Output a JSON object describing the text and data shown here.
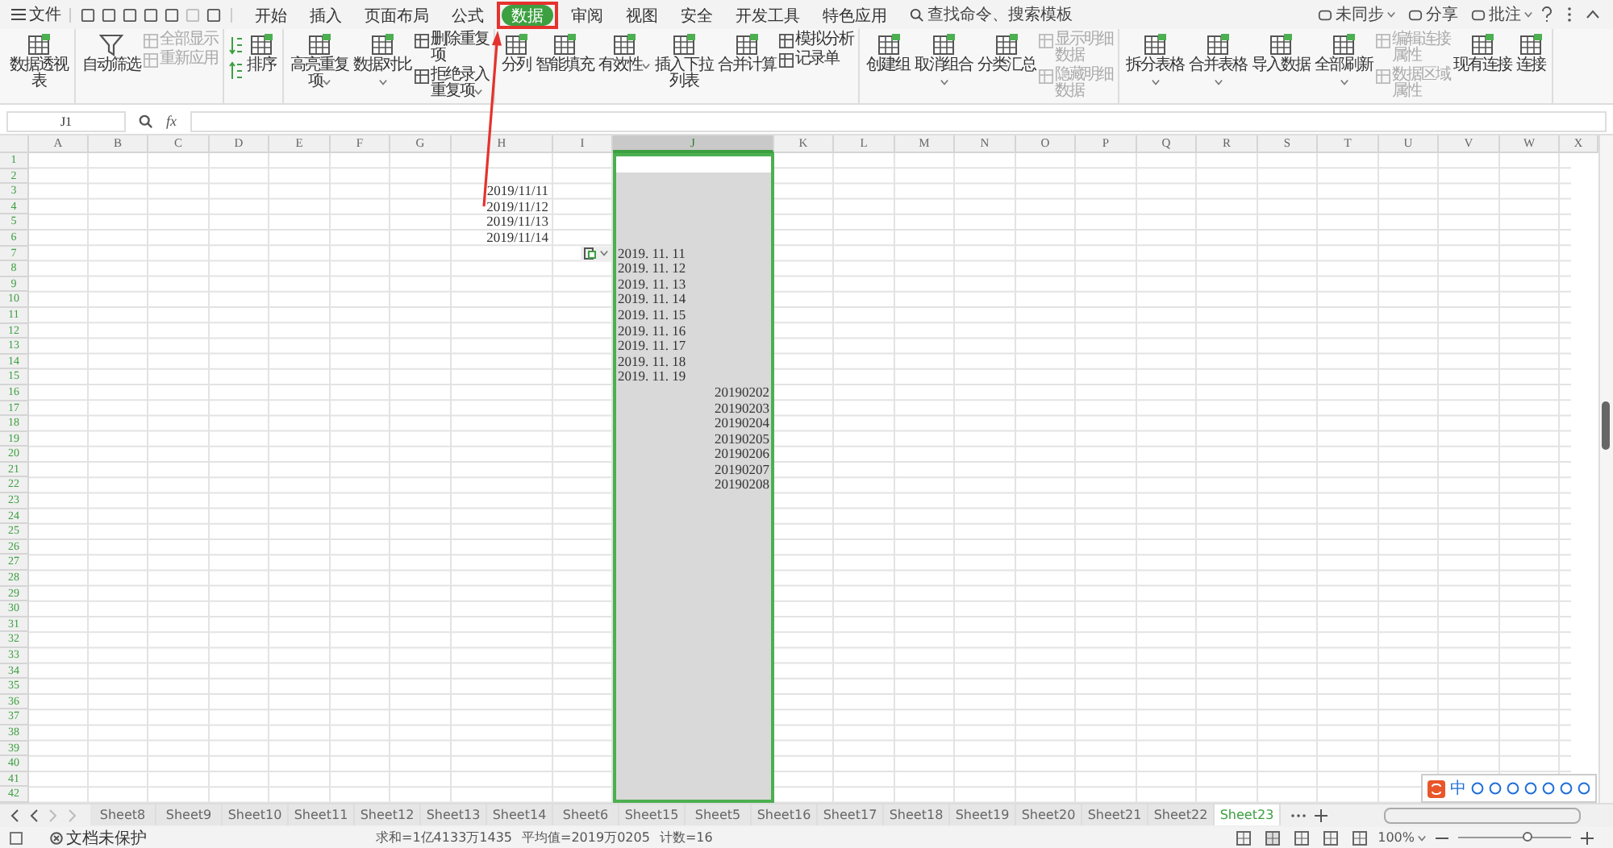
{
  "menu": {
    "file": "文件",
    "tabs": [
      {
        "label": "开始",
        "selected": false,
        "highlighted": false
      },
      {
        "label": "插入",
        "selected": false,
        "highlighted": false
      },
      {
        "label": "页面布局",
        "selected": false,
        "highlighted": false
      },
      {
        "label": "公式",
        "selected": false,
        "highlighted": false
      },
      {
        "label": "数据",
        "selected": true,
        "highlighted": true
      },
      {
        "label": "审阅",
        "selected": false,
        "highlighted": false
      },
      {
        "label": "视图",
        "selected": false,
        "highlighted": false
      },
      {
        "label": "安全",
        "selected": false,
        "highlighted": false
      },
      {
        "label": "开发工具",
        "selected": false,
        "highlighted": false
      },
      {
        "label": "特色应用",
        "selected": false,
        "highlighted": false
      }
    ],
    "search": {
      "placeholder": "查找命令、搜索模板"
    },
    "right": [
      {
        "label": "未同步",
        "dropdown": true
      },
      {
        "label": "分享",
        "dropdown": false
      },
      {
        "label": "批注",
        "dropdown": true
      }
    ]
  },
  "ribbon": {
    "groups": [
      {
        "items": [
          {
            "kind": "large",
            "label": "数据透视表",
            "dropdown": false,
            "disabled": false
          }
        ]
      },
      {
        "items": [
          {
            "kind": "large",
            "label": "自动筛选",
            "dropdown": false,
            "disabled": false
          },
          {
            "kind": "stack",
            "items": [
              {
                "label": "全部显示",
                "dropdown": false,
                "disabled": true
              },
              {
                "label": "重新应用",
                "dropdown": false,
                "disabled": true
              }
            ]
          }
        ]
      },
      {
        "items": [
          {
            "kind": "sort_icons"
          },
          {
            "kind": "large",
            "label": "排序",
            "dropdown": false,
            "disabled": false
          }
        ]
      },
      {
        "items": [
          {
            "kind": "large",
            "label": "高亮重复项",
            "dropdown": true,
            "disabled": false
          },
          {
            "kind": "large",
            "label": "数据对比",
            "dropdown": true,
            "disabled": false
          },
          {
            "kind": "stack",
            "items": [
              {
                "label": "删除重复项",
                "dropdown": false,
                "disabled": false
              },
              {
                "label": "拒绝录入重复项",
                "dropdown": true,
                "disabled": false
              }
            ]
          }
        ]
      },
      {
        "items": [
          {
            "kind": "large",
            "label": "分列",
            "dropdown": false,
            "disabled": false
          },
          {
            "kind": "large",
            "label": "智能填充",
            "dropdown": false,
            "disabled": false
          },
          {
            "kind": "large",
            "label": "有效性",
            "dropdown": true,
            "disabled": false
          },
          {
            "kind": "large",
            "label": "插入下拉列表",
            "dropdown": false,
            "disabled": false
          },
          {
            "kind": "large",
            "label": "合并计算",
            "dropdown": false,
            "disabled": false
          },
          {
            "kind": "stack",
            "items": [
              {
                "label": "模拟分析",
                "dropdown": false,
                "disabled": false
              },
              {
                "label": "记录单",
                "dropdown": false,
                "disabled": false
              }
            ]
          }
        ]
      },
      {
        "items": [
          {
            "kind": "large",
            "label": "创建组",
            "dropdown": false,
            "disabled": false
          },
          {
            "kind": "large",
            "label": "取消组合",
            "dropdown": true,
            "disabled": false
          },
          {
            "kind": "large",
            "label": "分类汇总",
            "dropdown": false,
            "disabled": false
          },
          {
            "kind": "stack",
            "items": [
              {
                "label": "显示明细数据",
                "dropdown": false,
                "disabled": true
              },
              {
                "label": "隐藏明细数据",
                "dropdown": false,
                "disabled": true
              }
            ]
          }
        ]
      },
      {
        "items": [
          {
            "kind": "large",
            "label": "拆分表格",
            "dropdown": true,
            "disabled": false
          },
          {
            "kind": "large",
            "label": "合并表格",
            "dropdown": true,
            "disabled": false
          },
          {
            "kind": "large",
            "label": "导入数据",
            "dropdown": false,
            "disabled": false
          },
          {
            "kind": "large",
            "label": "全部刷新",
            "dropdown": true,
            "disabled": false
          },
          {
            "kind": "stack",
            "items": [
              {
                "label": "编辑连接属性",
                "dropdown": false,
                "disabled": true
              },
              {
                "label": "数据区域属性",
                "dropdown": false,
                "disabled": true
              }
            ]
          },
          {
            "kind": "large",
            "label": "现有连接",
            "dropdown": false,
            "disabled": false
          },
          {
            "kind": "large",
            "label": "连接",
            "dropdown": false,
            "disabled": false
          }
        ]
      }
    ]
  },
  "formula_bar": {
    "name_box": "J1",
    "fx_label": "fx"
  },
  "columns": [
    {
      "label": "A",
      "selected": false
    },
    {
      "label": "B",
      "selected": false
    },
    {
      "label": "C",
      "selected": false
    },
    {
      "label": "D",
      "selected": false
    },
    {
      "label": "E",
      "selected": false
    },
    {
      "label": "F",
      "selected": false
    },
    {
      "label": "G",
      "selected": false
    },
    {
      "label": "H",
      "selected": false
    },
    {
      "label": "I",
      "selected": false
    },
    {
      "label": "J",
      "selected": true
    },
    {
      "label": "K",
      "selected": false
    },
    {
      "label": "L",
      "selected": false
    },
    {
      "label": "M",
      "selected": false
    },
    {
      "label": "N",
      "selected": false
    },
    {
      "label": "O",
      "selected": false
    },
    {
      "label": "P",
      "selected": false
    },
    {
      "label": "Q",
      "selected": false
    },
    {
      "label": "R",
      "selected": false
    },
    {
      "label": "S",
      "selected": false
    },
    {
      "label": "T",
      "selected": false
    },
    {
      "label": "U",
      "selected": false
    },
    {
      "label": "V",
      "selected": false
    },
    {
      "label": "W",
      "selected": false
    },
    {
      "label": "X",
      "selected": false
    }
  ],
  "rows": [
    {
      "label": "1"
    },
    {
      "label": "2"
    },
    {
      "label": "3",
      "cells": {
        "column_h": {
          "kind": "number",
          "text": "2019/11/11"
        }
      }
    },
    {
      "label": "4",
      "cells": {
        "column_h": {
          "kind": "number",
          "text": "2019/11/12"
        }
      }
    },
    {
      "label": "5",
      "cells": {
        "column_h": {
          "kind": "number",
          "text": "2019/11/13"
        }
      }
    },
    {
      "label": "6",
      "cells": {
        "column_h": {
          "kind": "number",
          "text": "2019/11/14"
        }
      }
    },
    {
      "label": "7",
      "cells": {
        "column_i": {
          "kind": "paste_options"
        },
        "column_j": {
          "kind": "text",
          "text": "2019. 11. 11"
        }
      }
    },
    {
      "label": "8",
      "cells": {
        "column_j": {
          "kind": "text",
          "text": "2019. 11. 12"
        }
      }
    },
    {
      "label": "9",
      "cells": {
        "column_j": {
          "kind": "text",
          "text": "2019. 11. 13"
        }
      }
    },
    {
      "label": "10",
      "cells": {
        "column_j": {
          "kind": "text",
          "text": "2019. 11. 14"
        }
      }
    },
    {
      "label": "11",
      "cells": {
        "column_j": {
          "kind": "text",
          "text": "2019. 11. 15"
        }
      }
    },
    {
      "label": "12",
      "cells": {
        "column_j": {
          "kind": "text",
          "text": "2019. 11. 16"
        }
      }
    },
    {
      "label": "13",
      "cells": {
        "column_j": {
          "kind": "text",
          "text": "2019. 11. 17"
        }
      }
    },
    {
      "label": "14",
      "cells": {
        "column_j": {
          "kind": "text",
          "text": "2019. 11. 18"
        }
      }
    },
    {
      "label": "15",
      "cells": {
        "column_j": {
          "kind": "text",
          "text": "2019. 11. 19"
        }
      }
    },
    {
      "label": "16",
      "cells": {
        "column_j": {
          "kind": "number",
          "text": "20190202"
        }
      }
    },
    {
      "label": "17",
      "cells": {
        "column_j": {
          "kind": "number",
          "text": "20190203"
        }
      }
    },
    {
      "label": "18",
      "cells": {
        "column_j": {
          "kind": "number",
          "text": "20190204"
        }
      }
    },
    {
      "label": "19",
      "cells": {
        "column_j": {
          "kind": "number",
          "text": "20190205"
        }
      }
    },
    {
      "label": "20",
      "cells": {
        "column_j": {
          "kind": "number",
          "text": "20190206"
        }
      }
    },
    {
      "label": "21",
      "cells": {
        "column_j": {
          "kind": "number",
          "text": "20190207"
        }
      }
    },
    {
      "label": "22",
      "cells": {
        "column_j": {
          "kind": "number",
          "text": "20190208"
        }
      }
    },
    {
      "label": "23"
    },
    {
      "label": "24"
    },
    {
      "label": "25"
    },
    {
      "label": "26"
    },
    {
      "label": "27"
    },
    {
      "label": "28"
    },
    {
      "label": "29"
    },
    {
      "label": "30"
    },
    {
      "label": "31"
    },
    {
      "label": "32"
    },
    {
      "label": "33"
    },
    {
      "label": "34"
    },
    {
      "label": "35"
    },
    {
      "label": "36"
    },
    {
      "label": "37"
    },
    {
      "label": "38"
    },
    {
      "label": "39"
    },
    {
      "label": "40"
    },
    {
      "label": "41"
    },
    {
      "label": "42"
    }
  ],
  "ime_bar": {
    "label": "中"
  },
  "sheet_tabs": [
    {
      "label": "Sheet8",
      "selected": false
    },
    {
      "label": "Sheet9",
      "selected": false
    },
    {
      "label": "Sheet10",
      "selected": false
    },
    {
      "label": "Sheet11",
      "selected": false
    },
    {
      "label": "Sheet12",
      "selected": false
    },
    {
      "label": "Sheet13",
      "selected": false
    },
    {
      "label": "Sheet14",
      "selected": false
    },
    {
      "label": "Sheet6",
      "selected": false
    },
    {
      "label": "Sheet15",
      "selected": false
    },
    {
      "label": "Sheet5",
      "selected": false
    },
    {
      "label": "Sheet16",
      "selected": false
    },
    {
      "label": "Sheet17",
      "selected": false
    },
    {
      "label": "Sheet18",
      "selected": false
    },
    {
      "label": "Sheet19",
      "selected": false
    },
    {
      "label": "Sheet20",
      "selected": false
    },
    {
      "label": "Sheet21",
      "selected": false
    },
    {
      "label": "Sheet22",
      "selected": false
    },
    {
      "label": "Sheet23",
      "selected": true
    }
  ],
  "status_bar": {
    "protection": "文档未保护",
    "stats": [
      "求和=1亿4133万1435",
      "平均值=2019万0205",
      "计数=16"
    ],
    "zoom": {
      "reading": "100%",
      "level": 0.62
    }
  }
}
